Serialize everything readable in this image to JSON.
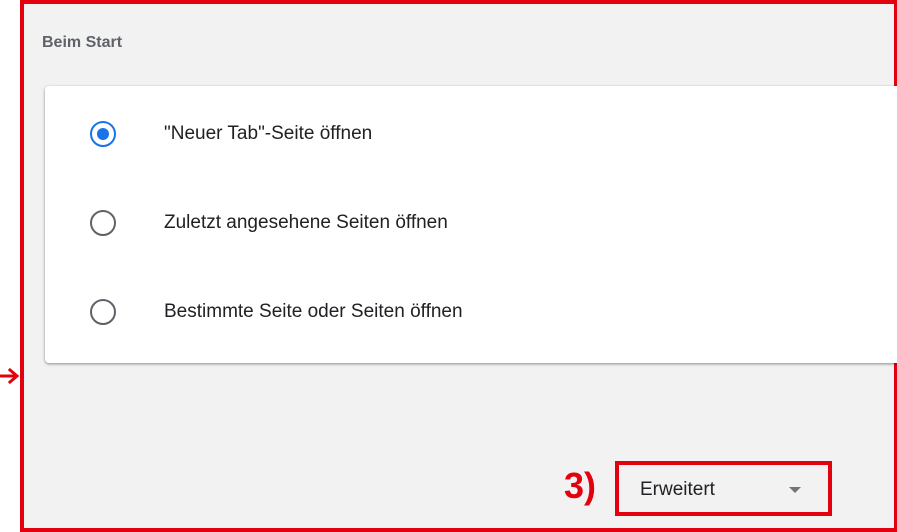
{
  "section": {
    "title": "Beim Start"
  },
  "startup_options": [
    {
      "label": "\"Neuer Tab\"-Seite öffnen",
      "checked": true
    },
    {
      "label": "Zuletzt angesehene Seiten öffnen",
      "checked": false
    },
    {
      "label": "Bestimmte Seite oder Seiten öffnen",
      "checked": false
    }
  ],
  "annotation": {
    "step_label": "3)",
    "color": "#e3000f"
  },
  "advanced": {
    "label": "Erweitert",
    "icon": "caret-down-icon"
  },
  "colors": {
    "accent": "#1a73e8",
    "panel_background": "#f2f2f2",
    "text": "#202124",
    "muted_text": "#5f6368"
  }
}
